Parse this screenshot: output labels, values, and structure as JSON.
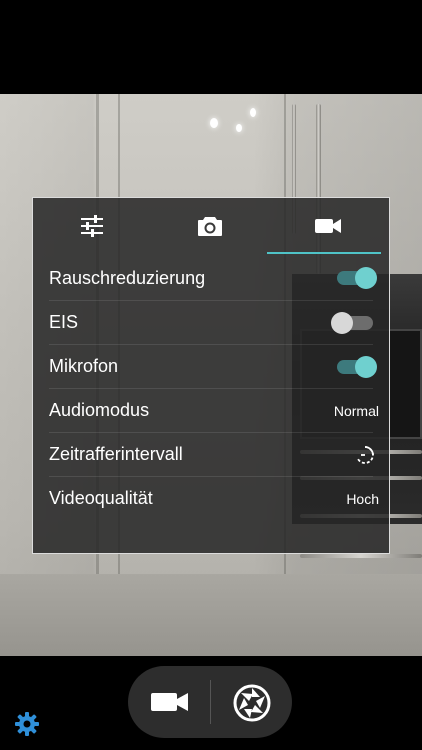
{
  "settings_panel": {
    "tabs": [
      {
        "name": "sliders-icon",
        "active": false
      },
      {
        "name": "camera-icon",
        "active": false
      },
      {
        "name": "video-camera-icon",
        "active": true
      }
    ],
    "rows": [
      {
        "label": "Rauschreduzierung",
        "control": "switch",
        "state": "on"
      },
      {
        "label": "EIS",
        "control": "switch",
        "state": "off"
      },
      {
        "label": "Mikrofon",
        "control": "switch",
        "state": "on"
      },
      {
        "label": "Audiomodus",
        "control": "value",
        "value": "Normal"
      },
      {
        "label": "Zeitrafferintervall",
        "control": "icon",
        "icon": "timer-icon"
      },
      {
        "label": "Videoqualität",
        "control": "value",
        "value": "Hoch"
      }
    ]
  },
  "bottom_controls": {
    "settings_icon": "gear-icon",
    "video_icon": "video-camera-icon",
    "shutter_icon": "shutter-icon"
  },
  "colors": {
    "accent": "#4fc3c7",
    "switch_on_knob": "#6fd0cf",
    "panel_bg": "#262626"
  }
}
